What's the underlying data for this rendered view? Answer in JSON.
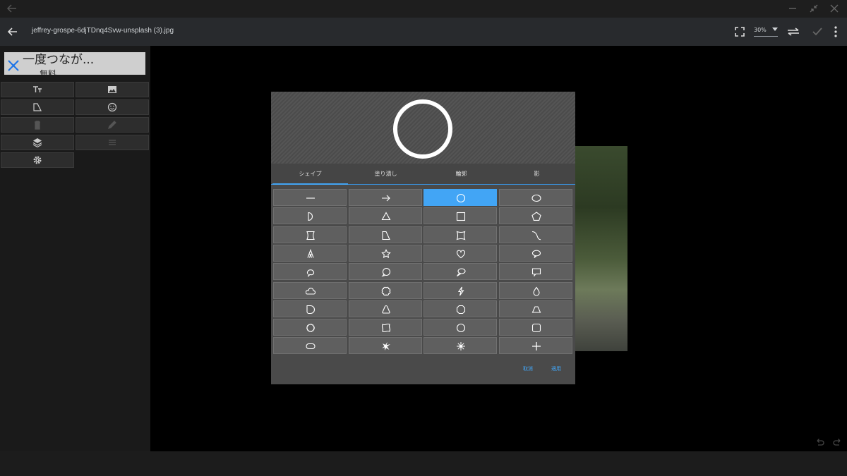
{
  "window": {
    "back_icon": "arrow-left-icon",
    "minimize_icon": "minimize-icon",
    "restore_icon": "restore-icon",
    "close_icon": "close-icon"
  },
  "toolbar": {
    "filename": "jeffrey-grospe-6djTDnq4Svw-unsplash (3).jpg",
    "zoom": "30%"
  },
  "ad": {
    "line1": "一度つなが...",
    "line2": "無料"
  },
  "dialog": {
    "tabs": [
      "シェイプ",
      "塗り潰し",
      "輪郭",
      "影"
    ],
    "active_tab": 0,
    "selected_shape": 2,
    "cancel_label": "取消",
    "apply_label": "適用"
  },
  "colors": {
    "accent": "#42a5f5"
  }
}
